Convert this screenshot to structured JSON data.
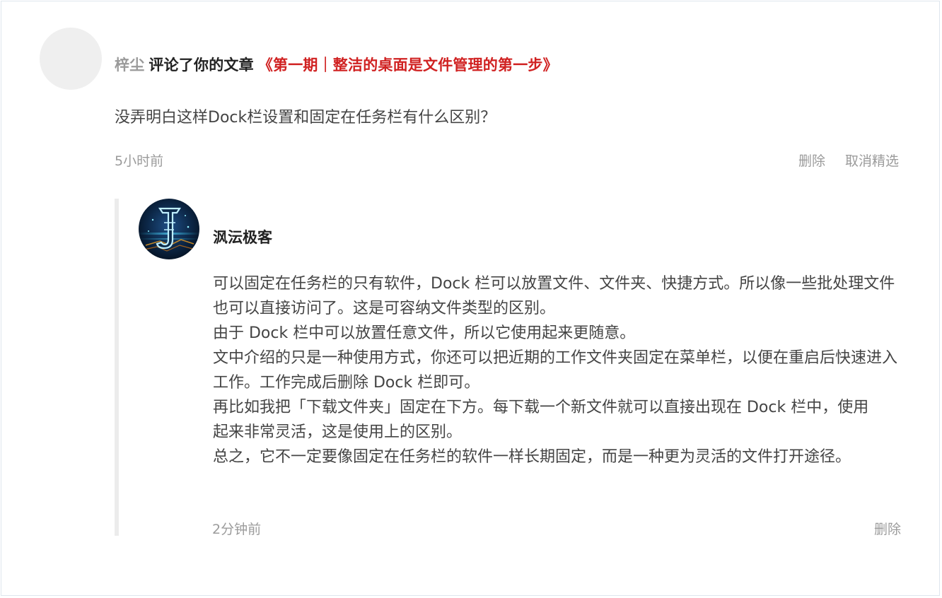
{
  "comment": {
    "username": "梓尘",
    "action": "评论了你的文章",
    "article_title": "《第一期｜整洁的桌面是文件管理的第一步》",
    "text": "没弄明白这样Dock栏设置和固定在任务栏有什么区别？",
    "time": "5小时前",
    "delete_label": "删除",
    "unfeature_label": "取消精选"
  },
  "reply": {
    "author": "沨沄极客",
    "paragraphs": [
      "可以固定在任务栏的只有软件，Dock 栏可以放置文件、文件夹、快捷方式。所以像一些批处理文件也可以直接访问了。这是可容纳文件类型的区别。",
      "由于 Dock 栏中可以放置任意文件，所以它使用起来更随意。",
      "文中介绍的只是一种使用方式，你还可以把近期的工作文件夹固定在菜单栏，以便在重启后快速进入工作。工作完成后删除 Dock 栏即可。",
      "再比如我把「下载文件夹」固定在下方。每下载一个新文件就可以直接出现在 Dock 栏中，使用起来非常灵活，这是使用上的区别。",
      "总之，它不一定要像固定在任务栏的软件一样长期固定，而是一种更为灵活的文件打开途径。"
    ],
    "time": "2分钟前",
    "delete_label": "删除"
  },
  "colors": {
    "accent_red": "#d02121",
    "muted_gray": "#9b9b9b",
    "border": "#dfe6ee"
  }
}
